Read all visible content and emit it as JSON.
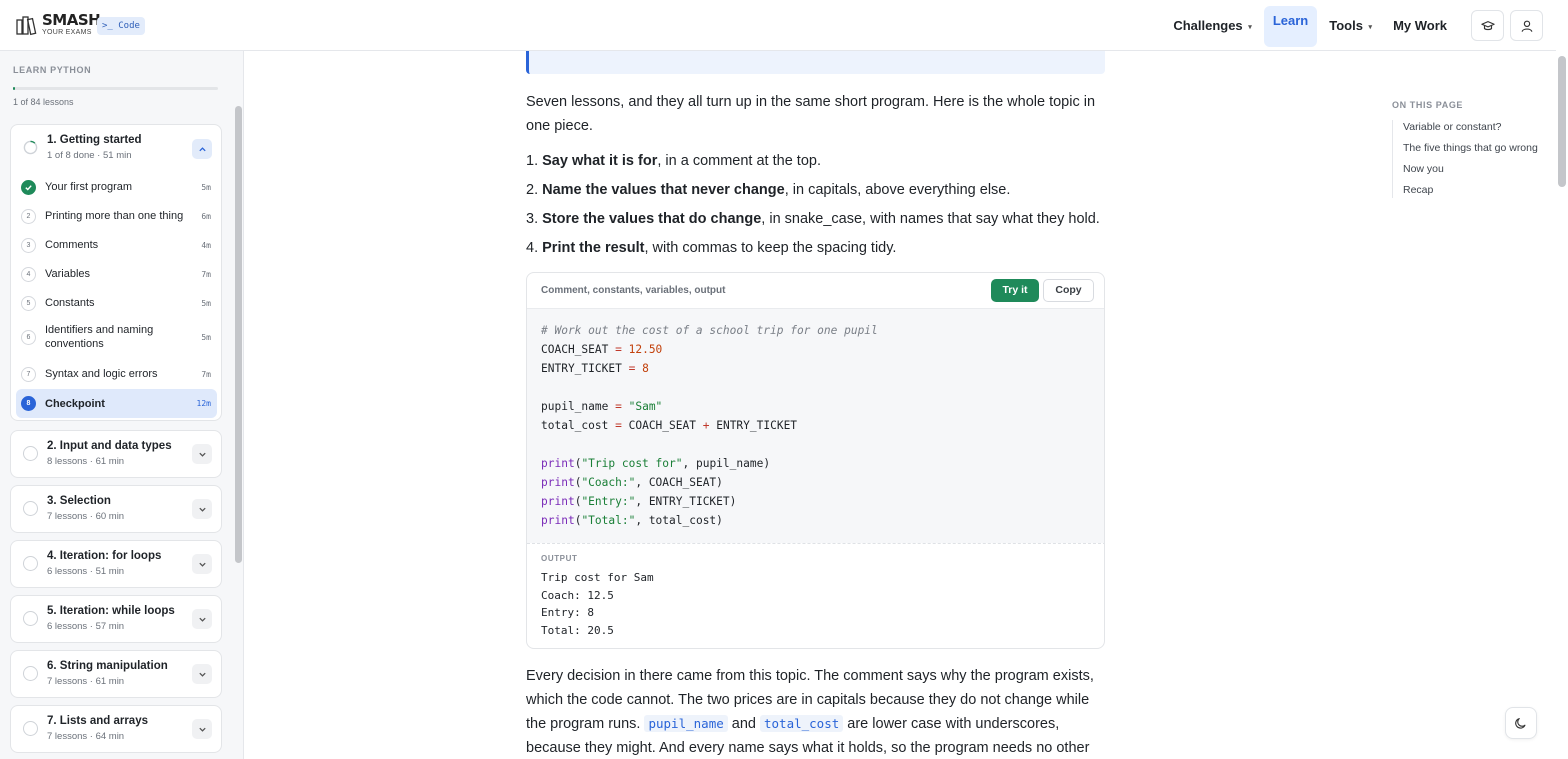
{
  "header": {
    "logo_line1": "SMASH",
    "logo_line2": "YOUR EXAMS",
    "badge": ">_ Code",
    "nav": [
      {
        "label": "Challenges",
        "caret": "▾"
      },
      {
        "label": "Learn"
      },
      {
        "label": "Tools",
        "caret": "▾"
      },
      {
        "label": "My Work"
      }
    ],
    "icons": [
      "graduation-cap-icon",
      "user-icon"
    ]
  },
  "sidebar": {
    "title": "LEARN PYTHON",
    "progress_fraction": 0.012,
    "count": "1 of 84 lessons",
    "modules": [
      {
        "title": "1. Getting started",
        "meta": "1 of 8 done · 51 min",
        "lessons": [
          {
            "num": "",
            "name": "Your first program",
            "time": "5m",
            "state": "done"
          },
          {
            "num": "2",
            "name": "Printing more than one thing",
            "time": "6m",
            "state": "todo"
          },
          {
            "num": "3",
            "name": "Comments",
            "time": "4m",
            "state": "todo"
          },
          {
            "num": "4",
            "name": "Variables",
            "time": "7m",
            "state": "todo"
          },
          {
            "num": "5",
            "name": "Constants",
            "time": "5m",
            "state": "todo"
          },
          {
            "num": "6",
            "name": "Identifiers and naming conventions",
            "time": "5m",
            "state": "todo"
          },
          {
            "num": "7",
            "name": "Syntax and logic errors",
            "time": "7m",
            "state": "todo"
          },
          {
            "num": "8",
            "name": "Checkpoint",
            "time": "12m",
            "state": "current"
          }
        ]
      },
      {
        "title": "2. Input and data types",
        "meta": "8 lessons · 61 min"
      },
      {
        "title": "3. Selection",
        "meta": "7 lessons · 60 min"
      },
      {
        "title": "4. Iteration: for loops",
        "meta": "6 lessons · 51 min"
      },
      {
        "title": "5. Iteration: while loops",
        "meta": "6 lessons · 57 min"
      },
      {
        "title": "6. String manipulation",
        "meta": "7 lessons · 61 min"
      },
      {
        "title": "7. Lists and arrays",
        "meta": "7 lessons · 64 min"
      }
    ]
  },
  "main": {
    "intro": "Seven lessons, and they all turn up in the same short program. Here is the whole topic in one piece.",
    "steps": [
      {
        "num": "1.",
        "bold": "Say what it is for",
        "rest": ", in a comment at the top."
      },
      {
        "num": "2.",
        "bold": "Name the values that never change",
        "rest": ", in capitals, above everything else."
      },
      {
        "num": "3.",
        "bold": "Store the values that do change",
        "rest": ", in snake_case, with names that say what they hold."
      },
      {
        "num": "4.",
        "bold": "Print the result",
        "rest": ", with commas to keep the spacing tidy."
      }
    ],
    "code_card": {
      "title": "Comment, constants, variables, output",
      "try_label": "Try it",
      "copy_label": "Copy",
      "code": {
        "comment": "# Work out the cost of a school trip for one pupil",
        "c1_name": "COACH_SEAT",
        "c1_val": "12.50",
        "c2_name": "ENTRY_TICKET",
        "c2_val": "8",
        "v1_name": "pupil_name",
        "v1_val": "\"Sam\"",
        "v2_name": "total_cost",
        "v2_a": "COACH_SEAT",
        "v2_b": "ENTRY_TICKET",
        "p_fn": "print",
        "p1_str": "\"Trip cost for\"",
        "p1_arg": "pupil_name",
        "p2_str": "\"Coach:\"",
        "p2_arg": "COACH_SEAT",
        "p3_str": "\"Entry:\"",
        "p3_arg": "ENTRY_TICKET",
        "p4_str": "\"Total:\"",
        "p4_arg": "total_cost",
        "op_eq": "=",
        "op_plus": "+"
      },
      "output_label": "OUTPUT",
      "output": [
        "Trip cost for Sam",
        "Coach: 12.5",
        "Entry: 8",
        "Total: 20.5"
      ]
    },
    "closing": {
      "text1": "Every decision in there came from this topic. The comment says why the program exists, which the code cannot. The two prices are in capitals because they do not change while the program runs. ",
      "code1": "pupil_name",
      "and": " and ",
      "code2": "total_cost",
      "text2": " are lower case with underscores, because they might. And every name says what it holds, so the program needs no other"
    }
  },
  "toc": {
    "title": "ON THIS PAGE",
    "items": [
      "Variable or constant?",
      "The five things that go wrong",
      "Now you",
      "Recap"
    ]
  },
  "colors": {
    "accent": "#2a64d8",
    "success": "#1f8a5a"
  }
}
